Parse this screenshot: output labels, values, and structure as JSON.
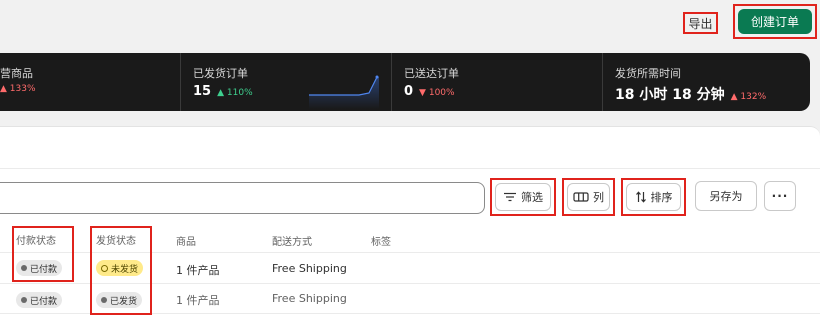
{
  "header": {
    "export_label": "导出",
    "create_label": "创建订单"
  },
  "metrics": [
    {
      "label": "营商品",
      "value": "",
      "change": "133%",
      "direction": "up",
      "trend_color": "#ff6b6b"
    },
    {
      "label": "已发货订单",
      "value": "15",
      "change": "110%",
      "direction": "up",
      "trend_color": "#3ecf8e"
    },
    {
      "label": "已送达订单",
      "value": "0",
      "change": "100%",
      "direction": "down",
      "trend_color": "#ff6b6b"
    },
    {
      "label": "发货所需时间",
      "value": "18 小时 18 分钟",
      "change": "132%",
      "direction": "up",
      "trend_color": "#ff6b6b"
    }
  ],
  "toolbar": {
    "filter_label": "筛选",
    "columns_label": "列",
    "sort_label": "排序",
    "save_as_label": "另存为",
    "more_label": "···"
  },
  "table": {
    "headers": {
      "payment_status": "付款状态",
      "fulfillment_status": "发货状态",
      "products": "商品",
      "shipping": "配送方式",
      "tags": "标签"
    },
    "rows": [
      {
        "payment_status": "已付款",
        "fulfillment_status": "未发货",
        "products": "1 件产品",
        "shipping": "Free Shipping"
      },
      {
        "payment_status": "已付款",
        "fulfillment_status": "已发货",
        "products": "1 件产品",
        "shipping": "Free Shipping"
      }
    ]
  },
  "colors": {
    "primary": "#0a7a52",
    "highlight": "#e0231c",
    "unfulfilled_badge": "#ffea8a"
  }
}
